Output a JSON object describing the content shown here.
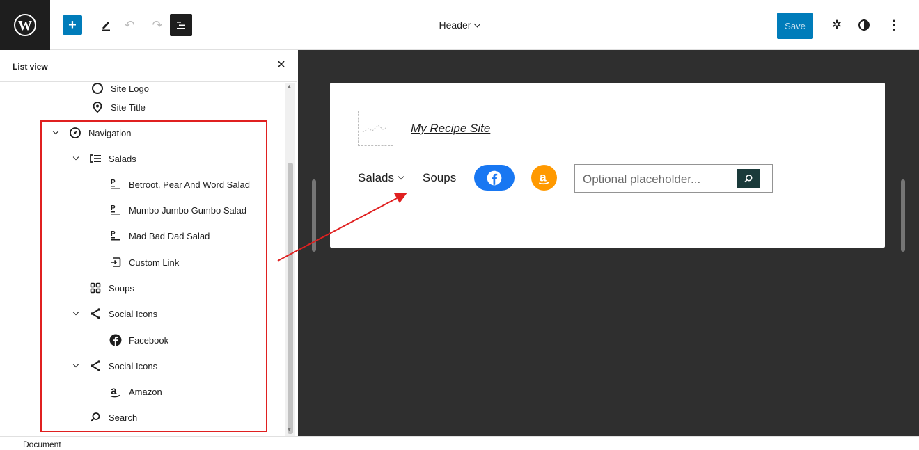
{
  "toolbar": {
    "document_title": "Header",
    "save_label": "Save",
    "icons": [
      "wordpress-logo",
      "plus-icon",
      "pen-icon",
      "undo-icon",
      "redo-icon",
      "list-view-icon",
      "chevron-down-icon",
      "gear-icon",
      "half-circle-icon",
      "more-vertical-icon"
    ]
  },
  "sidebar": {
    "title": "List view",
    "items": [
      {
        "label": "Site Logo",
        "icon": "site-logo-icon"
      },
      {
        "label": "Site Title",
        "icon": "map-pin-icon"
      },
      {
        "label": "Navigation",
        "icon": "compass-icon",
        "expanded": true
      },
      {
        "label": "Salads",
        "icon": "submenu-icon",
        "expanded": true
      },
      {
        "label": "Betroot, Pear And Word Salad",
        "icon": "page-icon"
      },
      {
        "label": "Mumbo Jumbo Gumbo Salad",
        "icon": "page-icon"
      },
      {
        "label": "Mad Bad Dad Salad",
        "icon": "page-icon"
      },
      {
        "label": "Custom Link",
        "icon": "custom-link-icon"
      },
      {
        "label": "Soups",
        "icon": "grid-icon"
      },
      {
        "label": "Social Icons",
        "icon": "share-icon",
        "expanded": true
      },
      {
        "label": "Facebook",
        "icon": "facebook-icon"
      },
      {
        "label": "Social Icons",
        "icon": "share-icon",
        "expanded": true
      },
      {
        "label": "Amazon",
        "icon": "amazon-icon"
      },
      {
        "label": "Search",
        "icon": "search-icon"
      }
    ]
  },
  "preview": {
    "site_title": "My Recipe Site",
    "nav": {
      "salads": "Salads",
      "soups": "Soups"
    },
    "search_placeholder": "Optional placeholder..."
  },
  "footer": {
    "breadcrumb": "Document"
  },
  "colors": {
    "accent": "#007cba",
    "annotation": "#e02020",
    "canvas": "#2f2f2f",
    "facebook": "#1877f2",
    "amazon": "#ff9900"
  }
}
